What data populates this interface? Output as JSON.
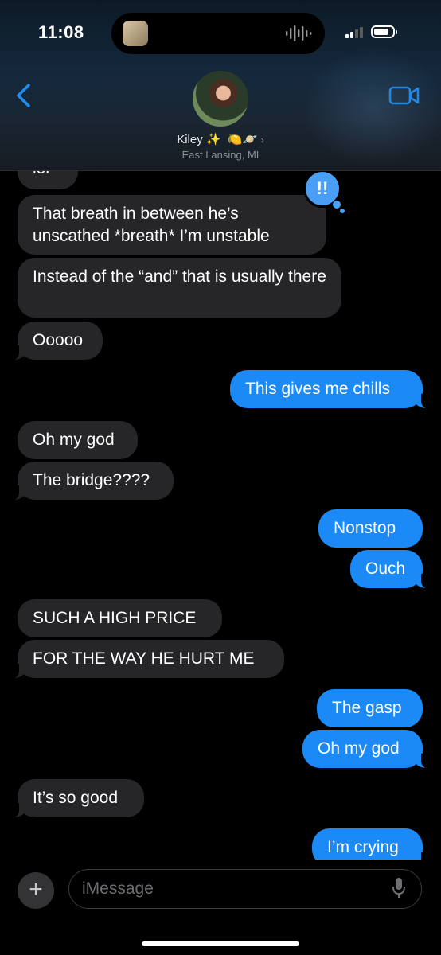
{
  "status": {
    "time": "11:08"
  },
  "contact": {
    "name": "Kiley",
    "name_emoji": "✨",
    "extra_emoji": "🍋🪐",
    "location": "East Lansing, MI"
  },
  "icons": {
    "back": "chevron-left-icon",
    "video": "video-camera-icon",
    "plus": "plus-icon",
    "mic": "microphone-icon",
    "tapback": "double-exclamation-icon"
  },
  "tapback_text": "!!",
  "messages": [
    {
      "side": "in",
      "text": "lol"
    },
    {
      "side": "in",
      "text": "That breath in between he’s unscathed *breath* I’m unstable"
    },
    {
      "side": "in",
      "text": "Instead of the “and” that is usually there"
    },
    {
      "side": "in",
      "text": "Ooooo"
    },
    {
      "side": "out",
      "text": "This gives me chills"
    },
    {
      "side": "in",
      "text": "Oh my god"
    },
    {
      "side": "in",
      "text": "The bridge????"
    },
    {
      "side": "out",
      "text": "Nonstop"
    },
    {
      "side": "out",
      "text": "Ouch"
    },
    {
      "side": "in",
      "text": "SUCH A HIGH PRICE"
    },
    {
      "side": "in",
      "text": "FOR THE WAY HE HURT ME"
    },
    {
      "side": "out",
      "text": "The gasp"
    },
    {
      "side": "out",
      "text": "Oh my god"
    },
    {
      "side": "in",
      "text": "It’s so good"
    },
    {
      "side": "out",
      "text": "I’m crying"
    }
  ],
  "composer": {
    "placeholder": "iMessage",
    "plus_label": "+"
  },
  "colors": {
    "incoming": "#262628",
    "outgoing": "#1b8af7",
    "accent": "#1e8cf0",
    "background": "#000000"
  }
}
